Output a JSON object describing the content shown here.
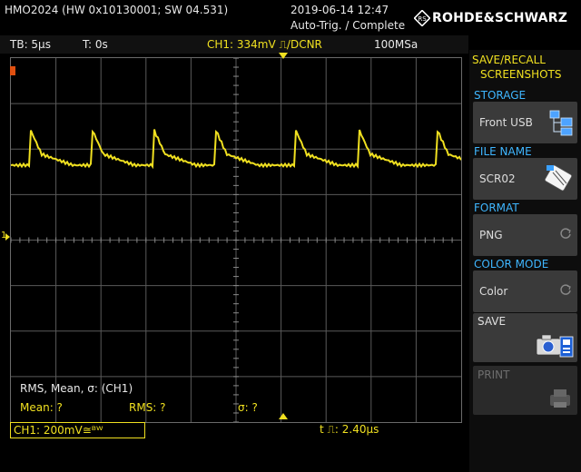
{
  "header": {
    "device": "HMO2024 (HW 0x10130001; SW 04.531)",
    "datetime": "2019-06-14 12:47",
    "trigger_status": "Auto-Trig. / Complete",
    "brand": "ROHDE&SCHWARZ"
  },
  "status_bar": {
    "timebase": "TB: 5µs",
    "time_offset": "T: 0s",
    "trigger": "CH1: 334mV ⎍/DCNR",
    "sample_rate": "100MSa"
  },
  "measurement": {
    "title": "RMS, Mean, σ: (CH1)",
    "mean_label": "Mean: ?",
    "rms_label": "RMS: ?",
    "sigma_label": "σ: ?"
  },
  "bottom_bar": {
    "channel": "CH1: 200mV≅ᴮᵂ",
    "pulse_width": "t ⎍: 2.40µs"
  },
  "menu": {
    "title_line1": "SAVE/RECALL",
    "title_line2": "SCREENSHOTS",
    "storage_label": "STORAGE",
    "storage_value": "Front USB",
    "file_name_label": "FILE NAME",
    "file_name_value": "SCR02",
    "format_label": "FORMAT",
    "format_value": "PNG",
    "color_mode_label": "COLOR MODE",
    "color_mode_value": "Color",
    "save_label": "SAVE",
    "print_label": "PRINT"
  },
  "markers": {
    "channel_marker": "1"
  },
  "colors": {
    "trace": "#f0e020",
    "menu_accent": "#3fb6ff",
    "menu_title": "#f0e020"
  }
}
